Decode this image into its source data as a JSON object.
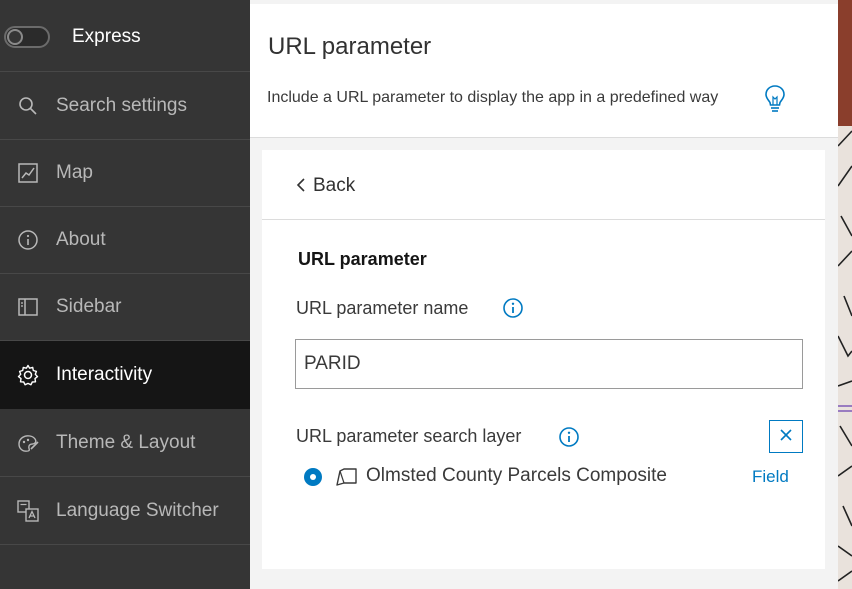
{
  "sidebar": {
    "express": {
      "label": "Express",
      "enabled": false
    },
    "items": [
      {
        "label": "Search settings",
        "icon": "search-icon"
      },
      {
        "label": "Map",
        "icon": "map-icon"
      },
      {
        "label": "About",
        "icon": "info-icon"
      },
      {
        "label": "Sidebar",
        "icon": "sidebar-icon"
      },
      {
        "label": "Interactivity",
        "icon": "gear-icon",
        "active": true
      },
      {
        "label": "Theme & Layout",
        "icon": "palette-icon"
      },
      {
        "label": "Language Switcher",
        "icon": "language-icon"
      }
    ]
  },
  "header": {
    "title": "URL parameter",
    "description": "Include a URL parameter to display the app in a predefined way"
  },
  "panel": {
    "back_label": "Back",
    "section_title": "URL parameter",
    "name_label": "URL parameter name",
    "name_value": "PARID",
    "layer_label": "URL parameter search layer",
    "layer_name": "Olmsted County Parcels Composite",
    "field_link": "Field"
  },
  "colors": {
    "sidebar_bg": "#353535",
    "sidebar_active_bg": "#151515",
    "accent": "#007ac2",
    "map_brown": "#8a3e2c"
  }
}
